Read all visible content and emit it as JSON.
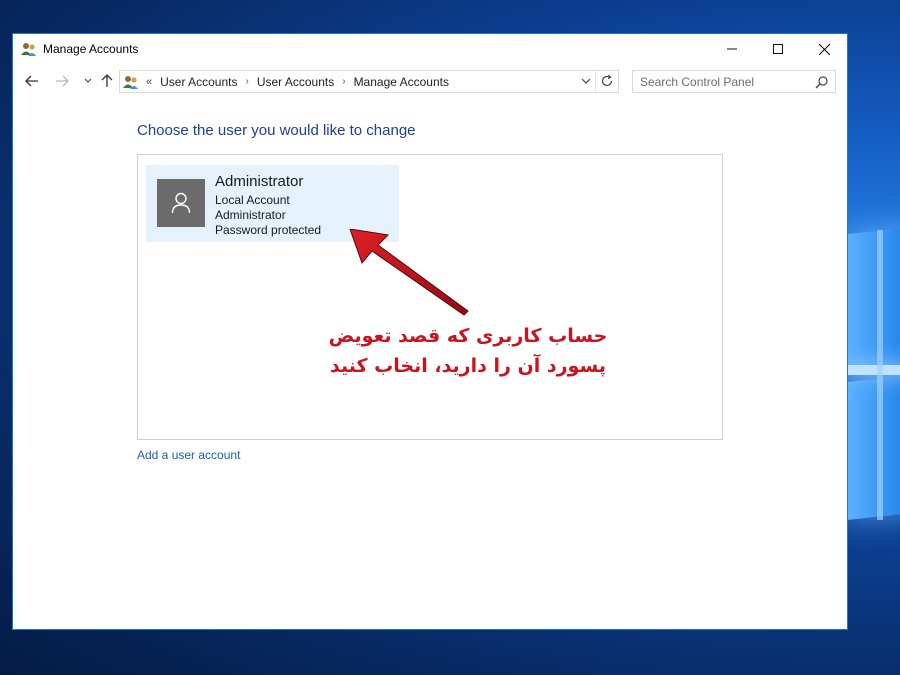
{
  "window": {
    "title": "Manage Accounts",
    "controls": {
      "minimize": "minimize-icon",
      "maximize": "maximize-icon",
      "close": "close-icon"
    }
  },
  "navigation": {
    "breadcrumb_prefix": "«",
    "breadcrumbs": [
      "User Accounts",
      "User Accounts",
      "Manage Accounts"
    ],
    "search_placeholder": "Search Control Panel"
  },
  "main": {
    "heading": "Choose the user you would like to change",
    "accounts": [
      {
        "name": "Administrator",
        "type": "Local Account",
        "role": "Administrator",
        "status": "Password protected"
      }
    ],
    "add_account_link": "Add a user account"
  },
  "annotation": {
    "line1": "حساب کاربری که قصد تعویض",
    "line2": "پسورد آن را دارید، انخاب کنید",
    "color": "#c8141e"
  },
  "colors": {
    "heading": "#1e3f8f",
    "link": "#1a5fb4",
    "tile_selected": "#e5f1fb",
    "window_border": "#1979ca"
  }
}
